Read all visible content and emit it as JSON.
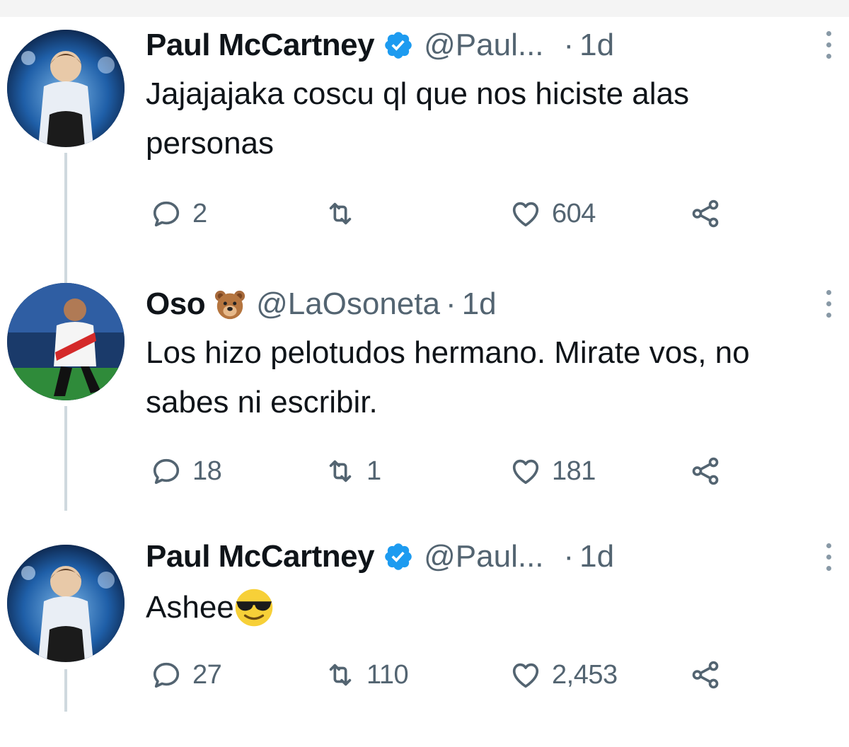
{
  "tweets": [
    {
      "name": "Paul McCartney",
      "handle": "@Paul...",
      "separator": "·",
      "time": "1d",
      "text": "Jajajajaka coscu ql que nos hiciste alas personas",
      "replies": "2",
      "retweets": "",
      "likes": "604",
      "verified": true,
      "name_emoji": ""
    },
    {
      "name": "Oso",
      "handle": "@LaOsoneta",
      "separator": "·",
      "time": "1d",
      "text": "Los hizo pelotudos hermano. Mirate vos, no sabes ni escribir.",
      "replies": "18",
      "retweets": "1",
      "likes": "181",
      "verified": false,
      "name_emoji": "bear-face-emoji"
    },
    {
      "name": "Paul McCartney",
      "handle": "@Paul...",
      "separator": "·",
      "time": "1d",
      "text": "Ashee",
      "replies": "27",
      "retweets": "110",
      "likes": "2,453",
      "verified": true,
      "name_emoji": "",
      "text_emoji": "sunglasses-emoji"
    }
  ],
  "icons": {
    "reply": "reply-icon",
    "retweet": "retweet-icon",
    "like": "like-icon",
    "share": "share-icon",
    "more": "more-options-icon"
  },
  "colors": {
    "verified": "#1d9bf0",
    "secondary_text": "#536471",
    "thread_line": "#cfd9de"
  }
}
